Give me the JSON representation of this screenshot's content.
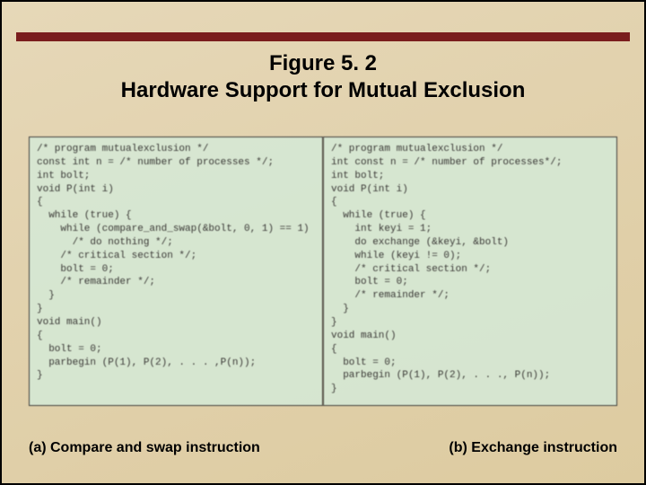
{
  "figure": {
    "number_line": "Figure 5. 2",
    "title_line": "Hardware Support for Mutual Exclusion"
  },
  "code_left": "/* program mutualexclusion */\nconst int n = /* number of processes */;\nint bolt;\nvoid P(int i)\n{\n  while (true) {\n    while (compare_and_swap(&bolt, 0, 1) == 1)\n      /* do nothing */;\n    /* critical section */;\n    bolt = 0;\n    /* remainder */;\n  }\n}\nvoid main()\n{\n  bolt = 0;\n  parbegin (P(1), P(2), . . . ,P(n));\n}\n",
  "code_right": "/* program mutualexclusion */\nint const n = /* number of processes*/;\nint bolt;\nvoid P(int i)\n{\n  while (true) {\n    int keyi = 1;\n    do exchange (&keyi, &bolt)\n    while (keyi != 0);\n    /* critical section */;\n    bolt = 0;\n    /* remainder */;\n  }\n}\nvoid main()\n{\n  bolt = 0;\n  parbegin (P(1), P(2), . . ., P(n));\n}\n",
  "captions": {
    "a": "(a) Compare and swap instruction",
    "b": "(b) Exchange instruction"
  }
}
